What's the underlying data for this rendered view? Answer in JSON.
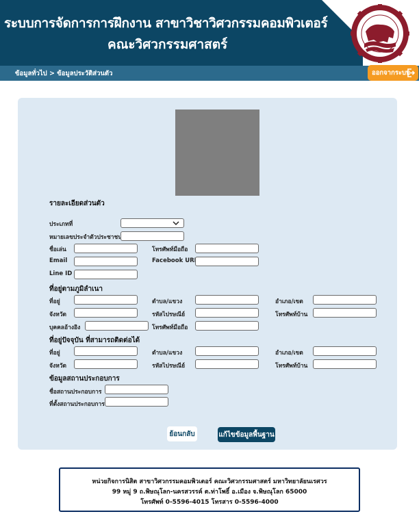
{
  "header": {
    "title_line1": "ระบบการจัดการการฝึกงาน สาขาวิชาวิศวกรรมคอมพิวเตอร์",
    "title_line2": "คณะวิศวกรรมศาสตร์",
    "brand_color": "#0c4664"
  },
  "nav": {
    "breadcrumb": "ข้อมูลทั่วไป > ข้อมูลประวัติส่วนตัว",
    "logout_label": "ออกจากระบบ",
    "logout_color": "#f59b22"
  },
  "personal": {
    "section": "รายละเอียดส่วนตัว",
    "type_label": "ประเภทที่",
    "type_value": "",
    "id_label": "หมายเลขประจำตัวประชาชน",
    "nickname_label": "ชื่อเล่น",
    "mobile_label": "โทรศัพท์มือถือ",
    "email_label": "Email",
    "facebook_label": "Facebook URL",
    "line_label": "Line ID"
  },
  "hometown": {
    "section": "ที่อยู่ตามภูมิลำเนา",
    "address_label": "ที่อยู่",
    "subdistrict_label": "ตำบล/แขวง",
    "district_label": "อำเภอ/เขต",
    "province_label": "จังหวัด",
    "postcode_label": "รหัสไปรษณีย์",
    "homephone_label": "โทรศัพท์บ้าน",
    "reference_label": "บุคคลอ้างอิง",
    "mobile_label": "โทรศัพท์มือถือ"
  },
  "current": {
    "section": "ที่อยู่ปัจจุบัน ที่สามารถติดต่อได้",
    "address_label": "ที่อยู่",
    "subdistrict_label": "ตำบล/แขวง",
    "district_label": "อำเภอ/เขต",
    "province_label": "จังหวัด",
    "postcode_label": "รหัสไปรษณีย์",
    "homephone_label": "โทรศัพท์บ้าน"
  },
  "workplace": {
    "section": "ข้อมูลสถานประกอบการ",
    "name_label": "ชื่อสถานประกอบการ",
    "location_label": "ที่ตั้งสถานประกอบการ"
  },
  "actions": {
    "back_label": "ย้อนกลับ",
    "edit_label": "แก้ไขข้อมูลพื้นฐาน"
  },
  "footer": {
    "line1": "หน่วยกิจการนิสิต สาขาวิศวกรรมคอมพิวเตอร์ คณะวิศวกรรมศาสตร์ มหาวิทยาลัยนเรศวร",
    "line2": "99 หมู่ 9 ถ.พิษณุโลก-นครสวรรค์ ต.ท่าโพธิ์ อ.เมือง จ.พิษณุโลก 65000",
    "line3": "โทรศัพท์ 0-5596-4015 โทรสาร 0-5596-4000"
  }
}
